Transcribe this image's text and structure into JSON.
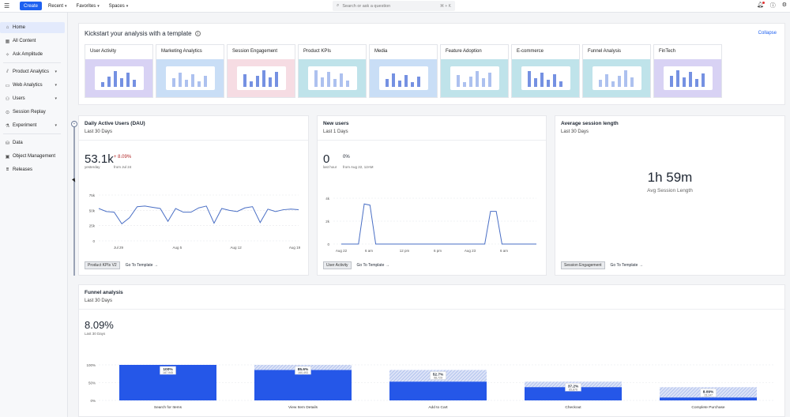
{
  "topbar": {
    "create_label": "Create",
    "nav": [
      {
        "label": "Recent"
      },
      {
        "label": "Favorites"
      },
      {
        "label": "Spaces"
      }
    ],
    "search_placeholder": "Search or ask a question",
    "search_shortcut": "⌘ + K"
  },
  "sidebar": {
    "items": [
      {
        "label": "Home",
        "icon": "home-icon"
      },
      {
        "label": "All Content",
        "icon": "grid-icon"
      },
      {
        "label": "Ask Amplitude",
        "icon": "sparkle-icon"
      },
      {
        "label": "Product Analytics",
        "icon": "chart-icon"
      },
      {
        "label": "Web Analytics",
        "icon": "monitor-icon"
      },
      {
        "label": "Users",
        "icon": "users-icon"
      },
      {
        "label": "Session Replay",
        "icon": "replay-icon"
      },
      {
        "label": "Experiment",
        "icon": "flask-icon"
      },
      {
        "label": "Data",
        "icon": "database-icon"
      },
      {
        "label": "Object Management",
        "icon": "box-icon"
      },
      {
        "label": "Releases",
        "icon": "releases-icon"
      }
    ]
  },
  "kickstart": {
    "title": "Kickstart your analysis with a template",
    "collapse_label": "Collapse",
    "templates": [
      {
        "name": "User Activity",
        "bg": "#d8d2f4"
      },
      {
        "name": "Marketing Analytics",
        "bg": "#c9def6"
      },
      {
        "name": "Session Engagement",
        "bg": "#f6dce3"
      },
      {
        "name": "Product KPIs",
        "bg": "#bfe3ea"
      },
      {
        "name": "Media",
        "bg": "#c9def6"
      },
      {
        "name": "Feature Adoption",
        "bg": "#bfe3ea"
      },
      {
        "name": "E-commerce",
        "bg": "#bfe3ea"
      },
      {
        "name": "Funnel Analysis",
        "bg": "#bfe3ea"
      },
      {
        "name": "FinTech",
        "bg": "#d8d2f4"
      }
    ]
  },
  "dau": {
    "title": "Daily Active Users (DAU)",
    "range": "Last 30 Days",
    "value": "53.1k",
    "value_sub": "yesterday",
    "delta": "+ 8.09%",
    "delta_sub": "from Jul 24",
    "tag": "Product KPIs V2",
    "goto": "Go To Template →"
  },
  "new_users": {
    "title": "New users",
    "range": "Last 1 Days",
    "value": "0",
    "value_sub": "last hour",
    "delta": "0%",
    "delta_sub": "from Aug 22, 12AM",
    "tag": "User Activity",
    "goto": "Go To Template →"
  },
  "session_length": {
    "title": "Average session length",
    "range": "Last 30 Days",
    "value": "1h 59m",
    "value_sub": "Avg Session Length",
    "tag": "Session Engagement",
    "goto": "Go To Template →"
  },
  "funnel": {
    "title": "Funnel analysis",
    "range": "Last 30 Days",
    "value": "8.09%",
    "value_sub": "Last 30 Days"
  },
  "chart_data": [
    {
      "type": "line",
      "title": "Daily Active Users (DAU)",
      "x_ticks": [
        "Jul 29",
        "Aug 5",
        "Aug 12",
        "Aug 19"
      ],
      "y_ticks": [
        "75k",
        "50k",
        "25k",
        "0"
      ],
      "ylim": [
        0,
        75000
      ],
      "color": "#4a6fc5",
      "values": [
        53000,
        48000,
        47000,
        28000,
        38000,
        56000,
        57000,
        55000,
        53000,
        32000,
        53000,
        47000,
        47000,
        54000,
        57000,
        29000,
        53000,
        50000,
        48000,
        54000,
        56000,
        30000,
        52000,
        48000,
        51000,
        52000,
        51000
      ]
    },
    {
      "type": "line",
      "title": "New users",
      "x_ticks": [
        "Aug 22",
        "6 am",
        "12 pm",
        "6 pm",
        "Aug 23",
        "6 am"
      ],
      "y_ticks": [
        "4k",
        "2k",
        "0"
      ],
      "ylim": [
        0,
        4000
      ],
      "color": "#4a6fc5",
      "values": [
        0,
        0,
        0,
        0,
        3500,
        3400,
        0,
        0,
        0,
        0,
        0,
        0,
        0,
        0,
        0,
        0,
        0,
        0,
        0,
        0,
        0,
        0,
        0,
        0,
        0,
        0,
        2850,
        2850,
        0,
        0,
        0,
        0,
        0,
        0,
        0
      ]
    },
    {
      "type": "bar",
      "title": "Funnel analysis",
      "y_ticks": [
        "100%",
        "50%",
        "0%"
      ],
      "ylim": [
        0,
        100
      ],
      "color": "#2557e8",
      "categories": [
        "Search for Items",
        "View Item Details",
        "Add to Cart",
        "Checkout",
        "Complete Purchase"
      ],
      "conversion": [
        100,
        85.6,
        52.7,
        37.2,
        8.09
      ],
      "counts": [
        "187,945",
        "160,493",
        "98,729",
        "65,876",
        "15,147"
      ],
      "labels": [
        "100%",
        "85.6%",
        "52.7%",
        "37.2%",
        "8.09%"
      ],
      "step_fill": [
        100,
        85.6,
        61.6,
        70.6,
        21.8
      ]
    }
  ]
}
